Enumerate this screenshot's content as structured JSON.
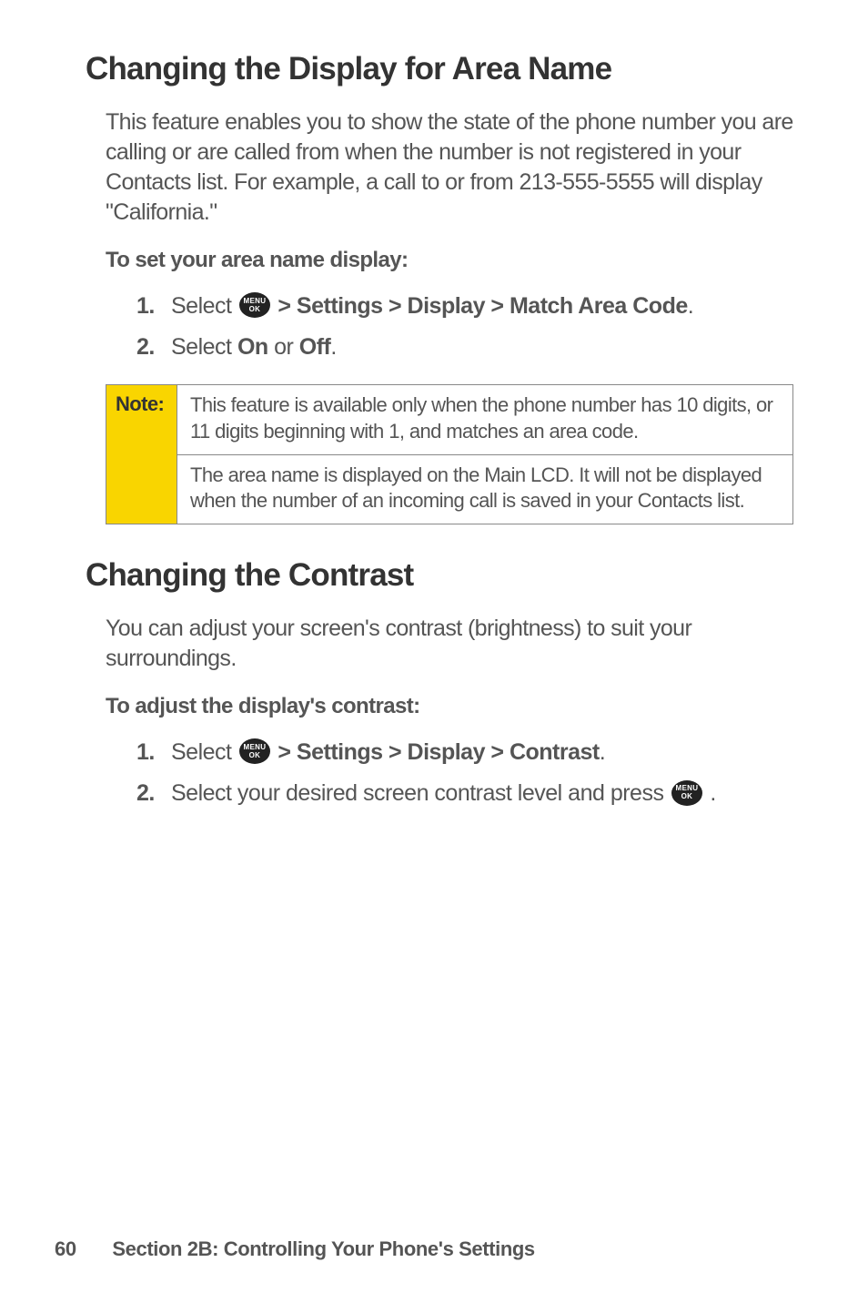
{
  "section1": {
    "heading": "Changing the Display for Area Name",
    "paragraph": "This feature enables you to show the state of the phone number you are calling or are called from when the number is not registered in your Contacts list. For example, a call to or from 213-555-5555 will display \"California.\"",
    "subhead": "To set your area name display:",
    "steps": [
      {
        "num": "1.",
        "lead": "Select ",
        "bold": " > Settings > Display > Match Area Code",
        "tail": "."
      },
      {
        "num": "2.",
        "lead": "Select ",
        "boldA": "On",
        "mid": " or ",
        "boldB": "Off",
        "tail": "."
      }
    ]
  },
  "note": {
    "label": "Note:",
    "seg1": "This feature is available only when the phone number has 10 digits, or 11 digits beginning with 1, and matches an area code.",
    "seg2": "The area name is displayed on the Main LCD. It will not be displayed when the number of an incoming call is saved in your Contacts list."
  },
  "section2": {
    "heading": "Changing the Contrast",
    "paragraph": "You can adjust your screen's contrast (brightness) to suit your surroundings.",
    "subhead": "To adjust the display's contrast:",
    "steps": [
      {
        "num": "1.",
        "lead": "Select ",
        "bold": " > Settings > Display > Contrast",
        "tail": "."
      },
      {
        "num": "2.",
        "lead": "Select your desired screen contrast level and press ",
        "tail": " ."
      }
    ]
  },
  "footer": {
    "page": "60",
    "title": "Section 2B: Controlling Your Phone's Settings"
  },
  "icon": {
    "l1": "MENU",
    "l2": "OK"
  }
}
